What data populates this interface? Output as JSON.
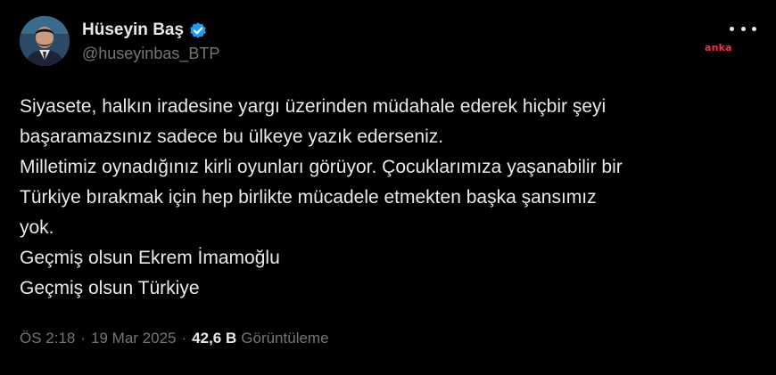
{
  "tweet": {
    "display_name": "Hüseyin Baş",
    "handle": "@huseyinbas_BTP",
    "lines": [
      "Siyasete, halkın iradesine yargı üzerinden müdahale ederek hiçbir şeyi",
      "başaramazsınız sadece bu ülkeye yazık ederseniz.",
      "Milletimiz oynadığınız kirli oyunları görüyor. Çocuklarımıza yaşanabilir bir",
      "Türkiye bırakmak için hep birlikte mücadele etmekten başka şansımız",
      "yok.",
      "Geçmiş olsun Ekrem İmamoğlu",
      "Geçmiş olsun Türkiye"
    ],
    "time": "ÖS 2:18",
    "separator": "·",
    "date": "19 Mar 2025",
    "views_count": "42,6 B",
    "views_label": "Görüntüleme"
  },
  "watermark": {
    "text": "anka"
  },
  "icons": {
    "verified": "verified-badge-icon",
    "more": "more-options-icon"
  },
  "colors": {
    "background": "#000000",
    "primary_text": "#e7e9ea",
    "secondary_text": "#71767b",
    "verified_blue": "#1d9bf0",
    "watermark_red": "#ff2a4a"
  }
}
